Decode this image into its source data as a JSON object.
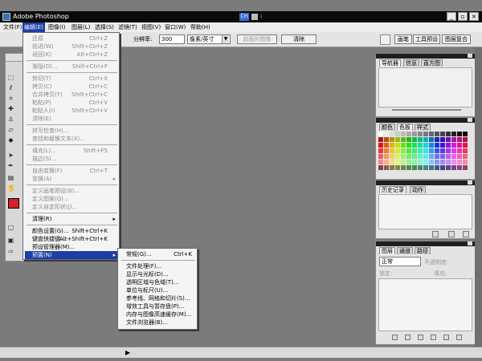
{
  "window": {
    "title": "Adobe Photoshop",
    "ime_lang": "CH",
    "minimize": "_",
    "restore": "▫",
    "close": "×"
  },
  "menubar": [
    {
      "label": "文件(F)",
      "key": "file"
    },
    {
      "label": "编辑(E)",
      "key": "edit"
    },
    {
      "label": "图像(I)",
      "key": "image"
    },
    {
      "label": "图层(L)",
      "key": "layer"
    },
    {
      "label": "选择(S)",
      "key": "select"
    },
    {
      "label": "滤镜(T)",
      "key": "filter"
    },
    {
      "label": "视图(V)",
      "key": "view"
    },
    {
      "label": "窗口(W)",
      "key": "window"
    },
    {
      "label": "帮助(H)",
      "key": "help"
    }
  ],
  "options_bar": {
    "resolution_label": "分辨率:",
    "resolution_value": "300",
    "unit_value": "像素/英寸",
    "front_image_button": "前面的图像",
    "clear_button": "清除",
    "wells": [
      "画笔",
      "工具预设",
      "图层复合"
    ]
  },
  "edit_menu": [
    {
      "label": "还原",
      "shortcut": "Ctrl+Z",
      "disabled": true
    },
    {
      "label": "前进(W)",
      "shortcut": "Shift+Ctrl+Z",
      "disabled": true
    },
    {
      "label": "返回(K)",
      "shortcut": "Alt+Ctrl+Z",
      "disabled": true
    },
    {
      "sep": true
    },
    {
      "label": "渐隐(D)...",
      "shortcut": "Shift+Ctrl+F",
      "disabled": true
    },
    {
      "sep": true
    },
    {
      "label": "剪切(T)",
      "shortcut": "Ctrl+X",
      "disabled": true
    },
    {
      "label": "拷贝(C)",
      "shortcut": "Ctrl+C",
      "disabled": true
    },
    {
      "label": "合并拷贝(Y)",
      "shortcut": "Shift+Ctrl+C",
      "disabled": true
    },
    {
      "label": "粘贴(P)",
      "shortcut": "Ctrl+V",
      "disabled": true
    },
    {
      "label": "粘贴入(I)",
      "shortcut": "Shift+Ctrl+V",
      "disabled": true
    },
    {
      "label": "清除(E)",
      "shortcut": "",
      "disabled": true
    },
    {
      "sep": true
    },
    {
      "label": "拼写检查(H)...",
      "shortcut": "",
      "disabled": true
    },
    {
      "label": "查找和替换文本(X)...",
      "shortcut": "",
      "disabled": true
    },
    {
      "sep": true
    },
    {
      "label": "填充(L)...",
      "shortcut": "Shift+F5",
      "disabled": true
    },
    {
      "label": "描边(S)...",
      "shortcut": "",
      "disabled": true
    },
    {
      "sep": true
    },
    {
      "label": "自由变换(F)",
      "shortcut": "Ctrl+T",
      "disabled": true
    },
    {
      "label": "变换(A)",
      "shortcut": "",
      "disabled": true,
      "submenu": true
    },
    {
      "sep": true
    },
    {
      "label": "定义画笔预设(B)...",
      "shortcut": "",
      "disabled": true
    },
    {
      "label": "定义图案(Q)...",
      "shortcut": "",
      "disabled": true
    },
    {
      "label": "定义自定形状(J)...",
      "shortcut": "",
      "disabled": true
    },
    {
      "sep": true
    },
    {
      "label": "清理(R)",
      "shortcut": "",
      "disabled": false,
      "submenu": true
    },
    {
      "sep": true
    },
    {
      "label": "颜色设置(G)...",
      "shortcut": "Shift+Ctrl+K",
      "disabled": false
    },
    {
      "label": "键盘快捷键...",
      "shortcut": "Alt+Shift+Ctrl+K",
      "disabled": false
    },
    {
      "label": "预设管理器(M)...",
      "shortcut": "",
      "disabled": false
    },
    {
      "label": "预置(N)",
      "shortcut": "",
      "disabled": false,
      "submenu": true,
      "highlighted": true
    }
  ],
  "preferences_submenu": [
    {
      "label": "常规(G)...",
      "shortcut": "Ctrl+K"
    },
    {
      "sep": true
    },
    {
      "label": "文件处理(F)..."
    },
    {
      "label": "显示与光标(D)..."
    },
    {
      "label": "透明区域与色域(T)..."
    },
    {
      "label": "单位与标尺(U)..."
    },
    {
      "label": "参考线、网格和切片(S)..."
    },
    {
      "label": "增效工具与暂存盘(P)..."
    },
    {
      "label": "内存与图像高速缓存(M)..."
    },
    {
      "label": "文件浏览器(B)..."
    }
  ],
  "navigator_panel": {
    "tabs": [
      "导航器",
      "信息",
      "直方图"
    ]
  },
  "color_panel": {
    "tabs": [
      "颜色",
      "色板",
      "样式"
    ]
  },
  "history_panel": {
    "tabs": [
      "历史记录",
      "动作"
    ]
  },
  "layers_panel": {
    "tabs": [
      "图层",
      "通道",
      "路径"
    ],
    "blend_mode": "正常",
    "opacity_label": "不透明度:",
    "lock_label": "锁定:",
    "fill_label": "填充:"
  },
  "colors": {
    "foreground": "#d42026",
    "background": "#ffffff",
    "highlight": "#1c3ea8"
  }
}
